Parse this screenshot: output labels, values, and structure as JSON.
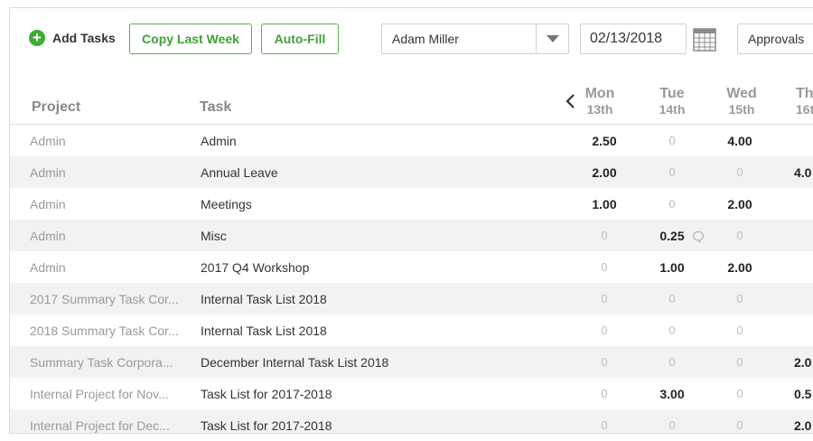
{
  "toolbar": {
    "add_tasks_label": "Add Tasks",
    "copy_last_week_label": "Copy Last Week",
    "auto_fill_label": "Auto-Fill",
    "user_select_value": "Adam Miller",
    "date_value": "02/13/2018",
    "approvals_label": "Approvals"
  },
  "header": {
    "project": "Project",
    "task": "Task",
    "days": [
      {
        "name": "Mon",
        "num": "13th"
      },
      {
        "name": "Tue",
        "num": "14th"
      },
      {
        "name": "Wed",
        "num": "15th"
      },
      {
        "name": "Th",
        "num": "16t"
      }
    ]
  },
  "rows": [
    {
      "project": "Admin",
      "task": "Admin",
      "mon": "2.50",
      "tue": "0",
      "wed": "4.00",
      "thu": ""
    },
    {
      "project": "Admin",
      "task": "Annual Leave",
      "mon": "2.00",
      "tue": "0",
      "wed": "0",
      "thu": "4.0"
    },
    {
      "project": "Admin",
      "task": "Meetings",
      "mon": "1.00",
      "tue": "0",
      "wed": "2.00",
      "thu": ""
    },
    {
      "project": "Admin",
      "task": "Misc",
      "mon": "0",
      "tue": "0.25",
      "wed": "0",
      "thu": ""
    },
    {
      "project": "Admin",
      "task": "2017 Q4 Workshop",
      "mon": "0",
      "tue": "1.00",
      "wed": "2.00",
      "thu": ""
    },
    {
      "project": "2017 Summary Task Cor...",
      "task": "Internal Task List 2018",
      "mon": "0",
      "tue": "0",
      "wed": "0",
      "thu": ""
    },
    {
      "project": "2018 Summary Task Cor...",
      "task": "Internal Task List 2018",
      "mon": "0",
      "tue": "0",
      "wed": "0",
      "thu": ""
    },
    {
      "project": "Summary Task Corpora...",
      "task": "December Internal Task List 2018",
      "mon": "0",
      "tue": "0",
      "wed": "0",
      "thu": "2.0"
    },
    {
      "project": "Internal Project for Nov...",
      "task": "Task List for 2017-2018",
      "mon": "0",
      "tue": "3.00",
      "wed": "0",
      "thu": "0.5"
    },
    {
      "project": "Internal Project for Dec...",
      "task": "Task List for 2017-2018",
      "mon": "0",
      "tue": "0",
      "wed": "0",
      "thu": "2.0"
    }
  ],
  "icons": {
    "add": "plus-circle-icon",
    "dropdown": "chevron-down-icon",
    "calendar": "calendar-icon",
    "prev": "chevron-left-icon",
    "comment": "comment-icon"
  },
  "colors": {
    "accent": "#3fab35",
    "row_alt": "#f2f2f2"
  }
}
